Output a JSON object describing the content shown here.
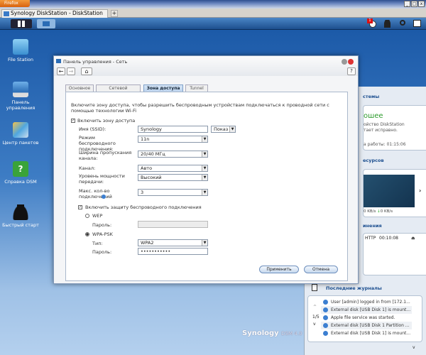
{
  "browser": {
    "menu_button": "Firefox",
    "tab_title": "Synology DiskStation - DiskStation",
    "new_tab": "+",
    "window_controls": [
      "_",
      "□",
      "x"
    ]
  },
  "taskbar": {
    "notification_count": "1"
  },
  "desktop": {
    "icons": [
      {
        "label": "File Station"
      },
      {
        "label": "Панель управления"
      },
      {
        "label": "Центр пакетов"
      },
      {
        "label": "Справка DSM"
      },
      {
        "label": "Быстрый старт"
      }
    ],
    "logo": "Synology",
    "logo_suffix": "DSM 4.0"
  },
  "window": {
    "title": "Панель управления - Сеть",
    "help": "?",
    "tabs": [
      {
        "label": "Основное"
      },
      {
        "label": "Сетевой интерфейс"
      },
      {
        "label": "Зона доступа"
      },
      {
        "label": "Tunnel"
      }
    ],
    "description": "Включите зону доступа, чтобы разрешить беспроводным устройствам подключаться к проводной сети с помощью технологии Wi-Fi",
    "enable_hotspot": "Включить зону доступа",
    "ssid_label": "Имя (SSID):",
    "ssid_value": "Synology",
    "ssid_broadcast": "Показ",
    "mode_label": "Режим беспроводного подключения:",
    "mode_value": "11n",
    "width_label": "Ширина пропускания канала:",
    "width_value": "20/40 МГц",
    "channel_label": "Канал:",
    "channel_value": "Авто",
    "power_label": "Уровень мощности передачи:",
    "power_value": "Высокий",
    "max_label": "Макс. кол-во подключений",
    "max_value": "3",
    "enable_security": "Включить защиту беспроводного подключения",
    "wep": "WEP",
    "wep_password_label": "Пароль:",
    "wpa": "WPA-PSK",
    "type_label": "Тип:",
    "type_value": "WPA2",
    "wpa_password_label": "Пароль:",
    "wpa_password_value": "•••••••••••",
    "apply": "Применить",
    "cancel": "Отмена"
  },
  "widgets": {
    "status_title": "стемы",
    "status_value": "ошее",
    "status_line1": "ойство DiskStation",
    "status_line2": "тает исправно.",
    "uptime": "а работы: 01:15:06",
    "resources_title": "есурсов",
    "net_up": "0 KB/s",
    "net_down": "0 KB/s",
    "connections_title": "инения",
    "conn_proto": "HTTP",
    "conn_time": "00:10:08",
    "logs_title": "Последние журналы",
    "logs_page": "1/5",
    "logs": [
      "User [admin] logged in from [172.1...",
      "External disk [USB Disk 1] is mount...",
      "Apple file service was started.",
      "External disk [USB Disk 1 Partition ...",
      "External disk [USB Disk 1] is mount..."
    ]
  }
}
